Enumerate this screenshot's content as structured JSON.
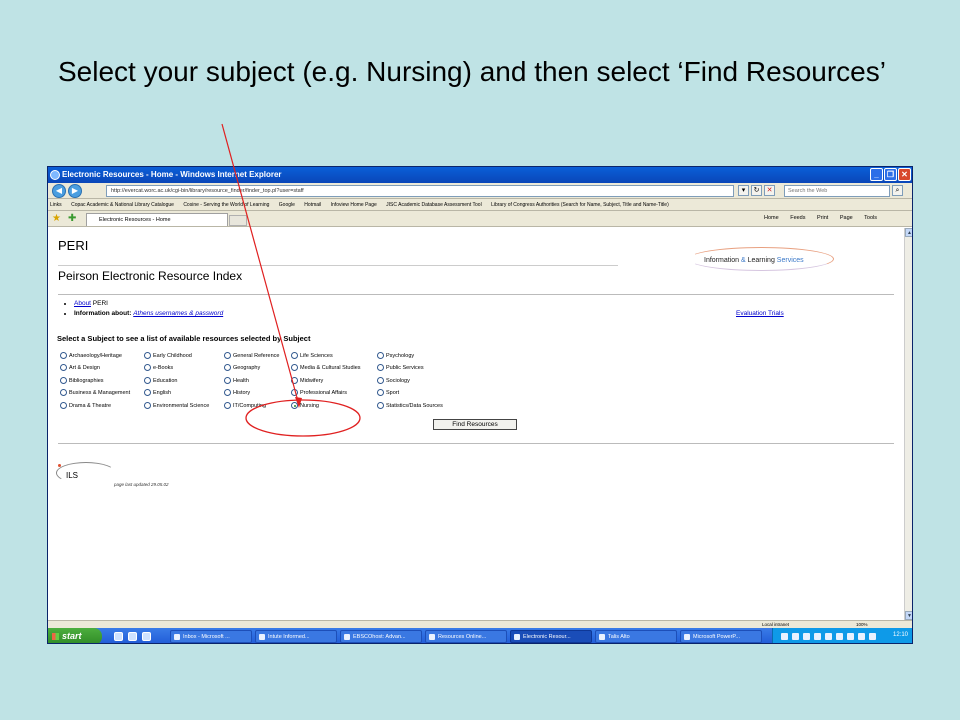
{
  "slide": {
    "title": "Select your subject (e.g. Nursing) and then select ‘Find Resources’"
  },
  "window": {
    "title": "Electronic Resources - Home - Windows Internet Explorer",
    "minimize": "_",
    "restore": "❐",
    "close": "✕"
  },
  "address_bar": {
    "back": "◀",
    "forward": "▶",
    "url": "http://evercat.worc.ac.uk/cgi-bin/library/resource_finder/finder_top.pl?user=staff",
    "search_placeholder": "Search the Web"
  },
  "links_bar": {
    "label": "Links",
    "items": [
      "Copac Academic & National Library Catalogue",
      "Cosine - Serving the World of Learning",
      "Google",
      "Hotmail",
      "Infoview Home Page",
      "JISC Academic Database Assessment Tool",
      "Library of Congress Authorities (Search for Name, Subject, Title and Name-Title)"
    ],
    "more": "»"
  },
  "tab_bar": {
    "active_tab": "Electronic Resources - Home",
    "tools": [
      "Home",
      "Feeds",
      "Print",
      "Page",
      "Tools"
    ]
  },
  "page": {
    "heading": "PERI",
    "subheading": "Peirson Electronic Resource Index",
    "brand": {
      "part1": "Information ",
      "amp": "& ",
      "part2": "Learning ",
      "part3": "Services"
    },
    "bullets": [
      {
        "link": "About",
        "text": " PERI"
      },
      {
        "prefix": "Information about: ",
        "link": "Athens usernames & password"
      }
    ],
    "evaluation_link": "Evaluation Trials",
    "select_heading": "Select a Subject to see a list of available resources selected by Subject",
    "subjects": {
      "col1": [
        "Archaeology/Heritage",
        "Art & Design",
        "Bibliographies",
        "Business & Management",
        "Drama & Theatre"
      ],
      "col2": [
        "Early Childhood",
        "e-Books",
        "Education",
        "English",
        "Environmental Science"
      ],
      "col3": [
        "General Reference",
        "Geography",
        "Health",
        "History",
        "IT/Computing"
      ],
      "col4": [
        "Life Sciences",
        "Media & Cultural Studies",
        "Midwifery",
        "Professional Affairs",
        "Nursing"
      ],
      "col5": [
        "Psychology",
        "Public Services",
        "Sociology",
        "Sport",
        "Statistics/Data Sources"
      ]
    },
    "selected_subject": "Nursing",
    "find_button": "Find Resources",
    "footer_logo": "ILS",
    "updated": "page last updated 29.05.02"
  },
  "status_bar": {
    "zone": "Local intranet",
    "zoom": "100%"
  },
  "taskbar": {
    "start": "start",
    "tasks": [
      "Inbox - Microsoft ...",
      "Intute Informed...",
      "EBSCOhost: Advan...",
      "Resources Online...",
      "Electronic Resour...",
      "Talis Alto",
      "Microsoft PowerP..."
    ],
    "active_task": 4,
    "clock": "12:10"
  },
  "colors": {
    "slide_background": "#bfe3e5",
    "callout": "#e02020",
    "titlebar": "#0a5fd8",
    "taskbar": "#1f5ad6",
    "start_button": "#3a9a30"
  }
}
